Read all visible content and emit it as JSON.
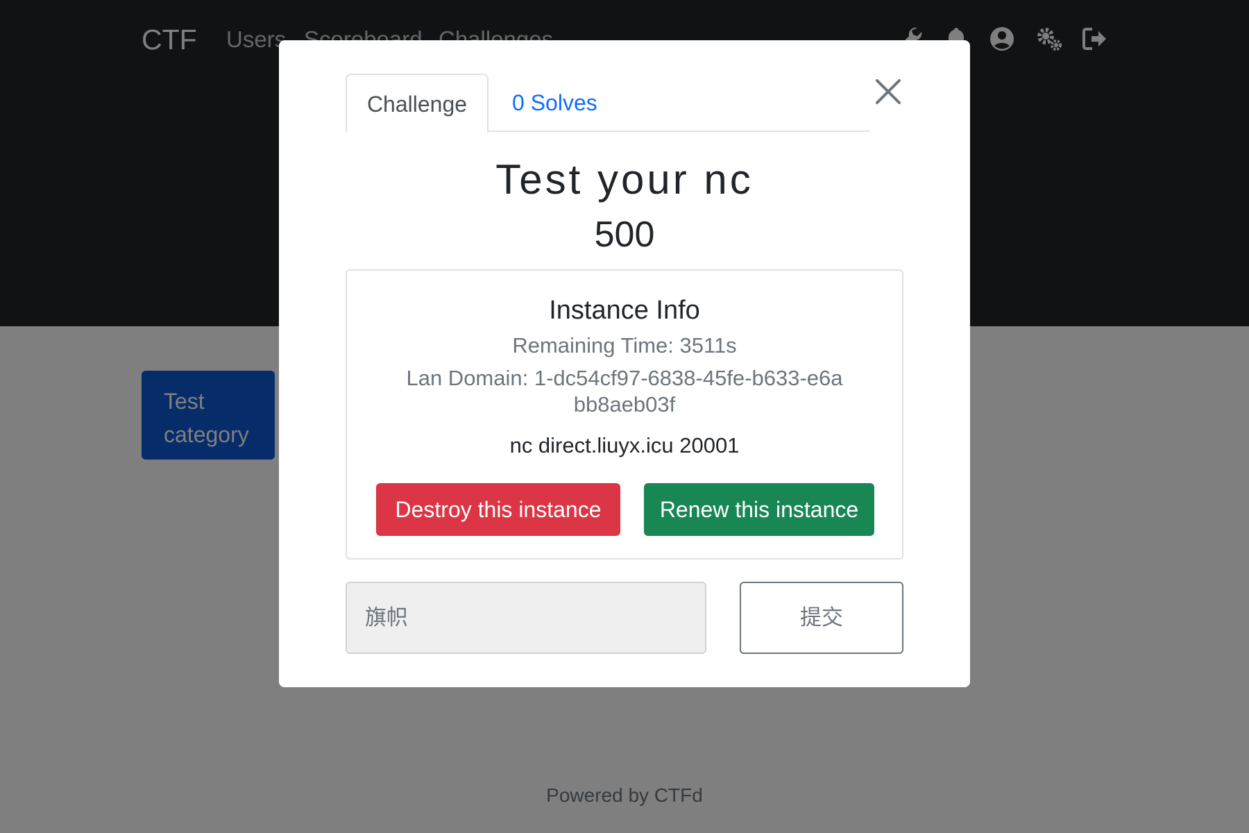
{
  "navbar": {
    "brand": "CTF",
    "links": [
      "Users",
      "Scoreboard",
      "Challenges"
    ],
    "icons": [
      "wrench-icon",
      "bell-icon",
      "user-circle-icon",
      "cogs-icon",
      "sign-out-icon"
    ]
  },
  "category": {
    "label": "Test category"
  },
  "footer": {
    "text": "Powered by CTFd"
  },
  "modal": {
    "tabs": [
      "Challenge",
      "0 Solves"
    ],
    "challenge_name": "Test your nc",
    "challenge_value": "500",
    "instance": {
      "title": "Instance Info",
      "remaining": "Remaining Time: 3511s",
      "domain": "Lan Domain: 1-dc54cf97-6838-45fe-b633-e6abb8aeb03f",
      "command": "nc direct.liuyx.icu 20001",
      "destroy_label": "Destroy this instance",
      "renew_label": "Renew this instance"
    },
    "flag_placeholder": "旗帜",
    "submit_label": "提交"
  },
  "colors": {
    "navbar_bg": "#212529",
    "primary": "#0d6efd",
    "danger": "#dc3545",
    "success": "#198754",
    "muted": "#6c757d"
  }
}
